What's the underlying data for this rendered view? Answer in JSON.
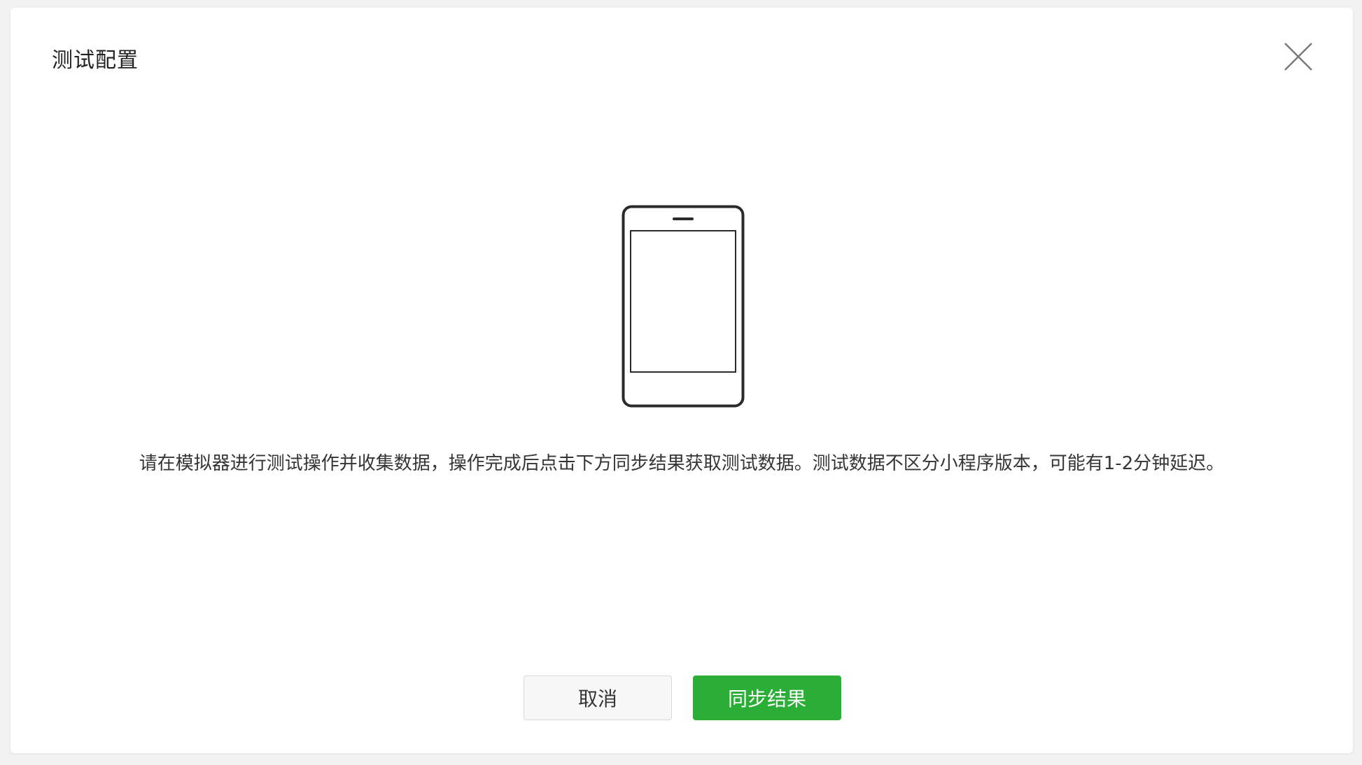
{
  "dialog": {
    "title": "测试配置",
    "close_icon": "close-icon"
  },
  "illustration": {
    "icon": "mobile-phone-icon"
  },
  "instruction": {
    "text": "请在模拟器进行测试操作并收集数据，操作完成后点击下方同步结果获取测试数据。测试数据不区分小程序版本，可能有1-2分钟延迟。"
  },
  "actions": {
    "cancel_label": "取消",
    "sync_label": "同步结果"
  },
  "colors": {
    "primary": "#2aae36",
    "text": "#353535",
    "border": "#d9d9d9"
  }
}
